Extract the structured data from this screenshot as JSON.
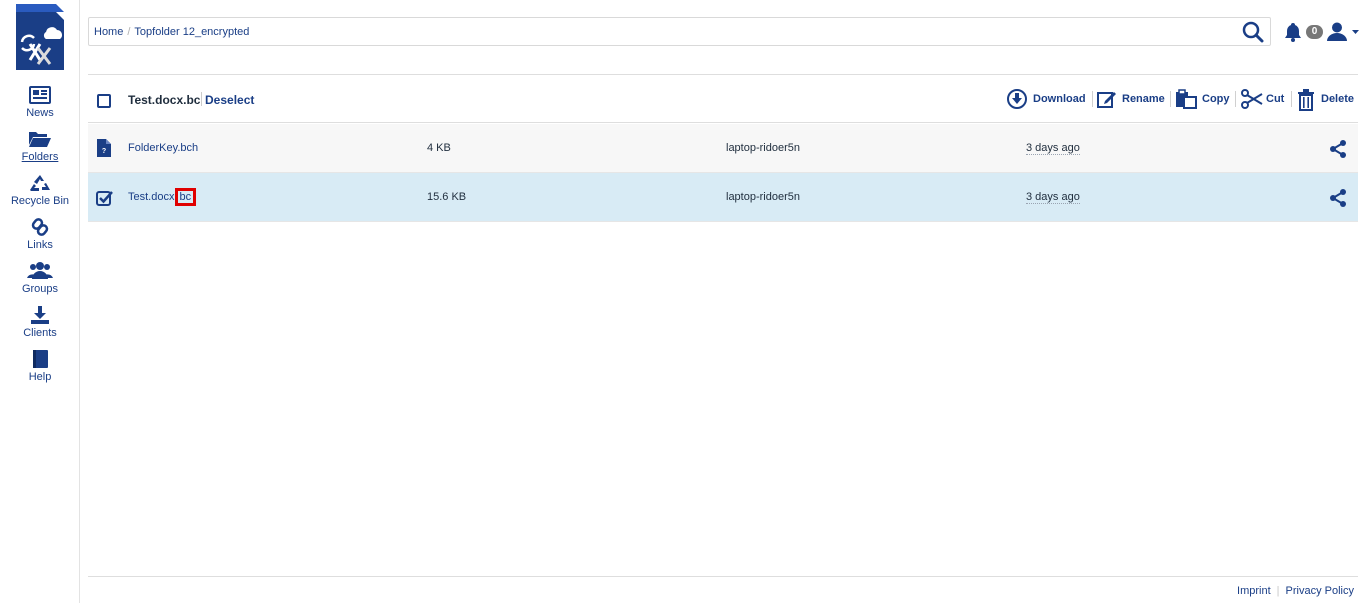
{
  "sidebar": {
    "items": [
      {
        "label": "News",
        "icon": "newspaper-icon"
      },
      {
        "label": "Folders",
        "icon": "folder-open-icon",
        "active": true
      },
      {
        "label": "Recycle Bin",
        "icon": "recycle-icon"
      },
      {
        "label": "Links",
        "icon": "link-icon"
      },
      {
        "label": "Groups",
        "icon": "users-icon"
      },
      {
        "label": "Clients",
        "icon": "download-icon"
      },
      {
        "label": "Help",
        "icon": "book-icon"
      }
    ]
  },
  "header": {
    "breadcrumb": [
      "Home",
      "Topfolder 12_encrypted"
    ],
    "notification_count": "0"
  },
  "toolbar": {
    "selected_name": "Test.docx.bc",
    "deselect_label": "Deselect",
    "actions": {
      "download": "Download",
      "rename": "Rename",
      "copy": "Copy",
      "cut": "Cut",
      "delete": "Delete"
    }
  },
  "files": [
    {
      "name": "FolderKey.bch",
      "size": "4 KB",
      "device": "laptop-ridoer5n",
      "modified": "3 days ago",
      "selected": false
    },
    {
      "name_base": "Test.docx.",
      "name_ext": "bc",
      "size": "15.6 KB",
      "device": "laptop-ridoer5n",
      "modified": "3 days ago",
      "selected": true
    }
  ],
  "footer": {
    "imprint": "Imprint",
    "privacy": "Privacy Policy"
  },
  "colors": {
    "brand": "#1a3e86",
    "selected_row": "#d8ebf5",
    "highlight": "#e00000"
  }
}
